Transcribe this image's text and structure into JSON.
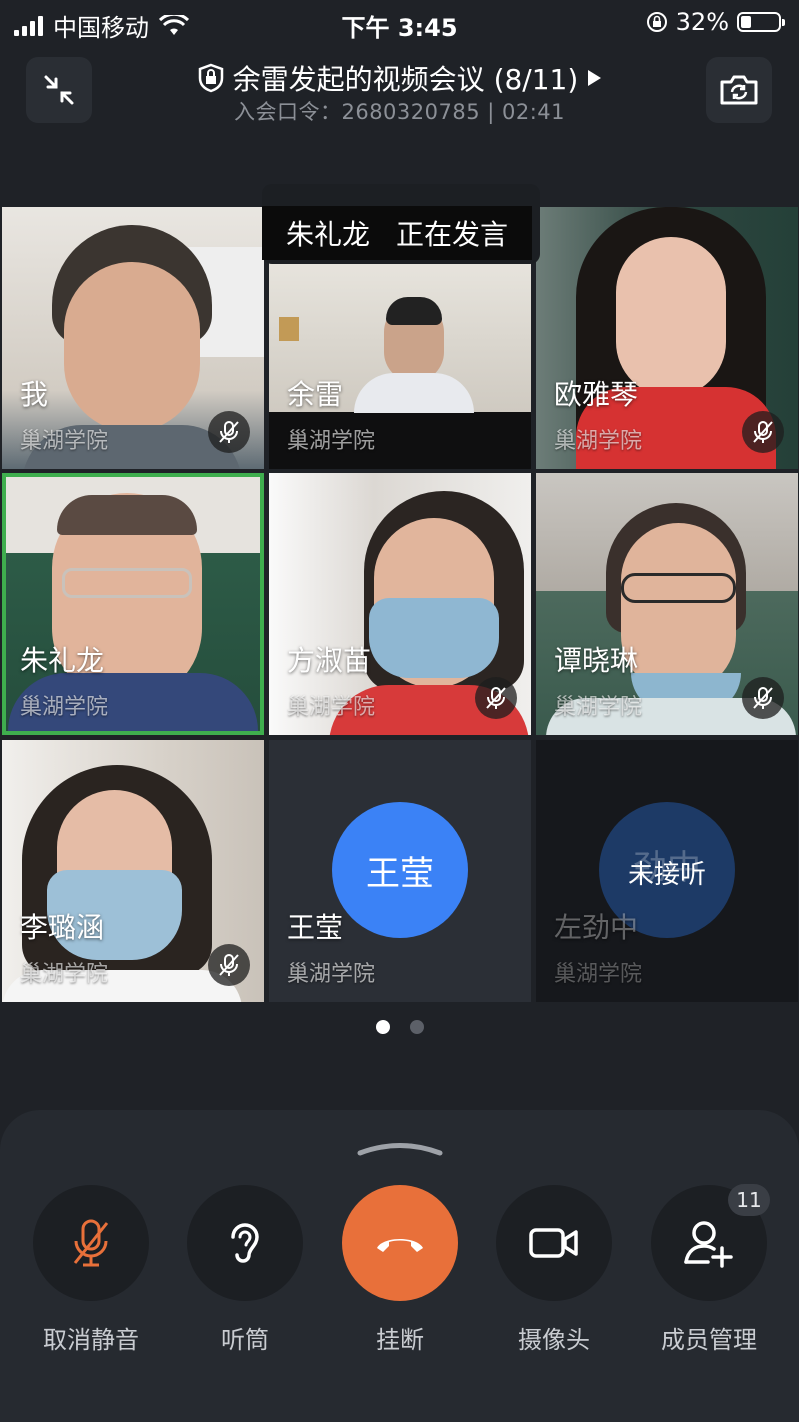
{
  "status_bar": {
    "carrier": "中国移动",
    "time": "下午 3:45",
    "battery": "32%"
  },
  "header": {
    "title": "余雷发起的视频会议 (8/11)",
    "subtitle": "入会口令：2680320785 | 02:41"
  },
  "speaking": {
    "name": "朱礼龙",
    "status": "正在发言"
  },
  "participants": [
    {
      "name": "我",
      "org": "巢湖学院"
    },
    {
      "name": "余雷",
      "org": "巢湖学院"
    },
    {
      "name": "欧雅琴",
      "org": "巢湖学院"
    },
    {
      "name": "朱礼龙",
      "org": "巢湖学院"
    },
    {
      "name": "方淑苗",
      "org": "巢湖学院"
    },
    {
      "name": "谭晓琳",
      "org": "巢湖学院"
    },
    {
      "name": "李璐涵",
      "org": "巢湖学院"
    },
    {
      "name": "王莹",
      "org": "巢湖学院",
      "avatar": "王莹"
    },
    {
      "name": "左劲中",
      "org": "巢湖学院",
      "avatar": "劲中",
      "state": "未接听"
    }
  ],
  "controls": {
    "unmute": "取消静音",
    "earpiece": "听筒",
    "hangup": "挂断",
    "camera": "摄像头",
    "members": "成员管理",
    "member_count": "11"
  },
  "colors": {
    "hangup": "#e8703a",
    "avatar_blue": "#3b82f6",
    "avatar_dark": "#1d3a66",
    "active_border": "#3fae4e"
  }
}
